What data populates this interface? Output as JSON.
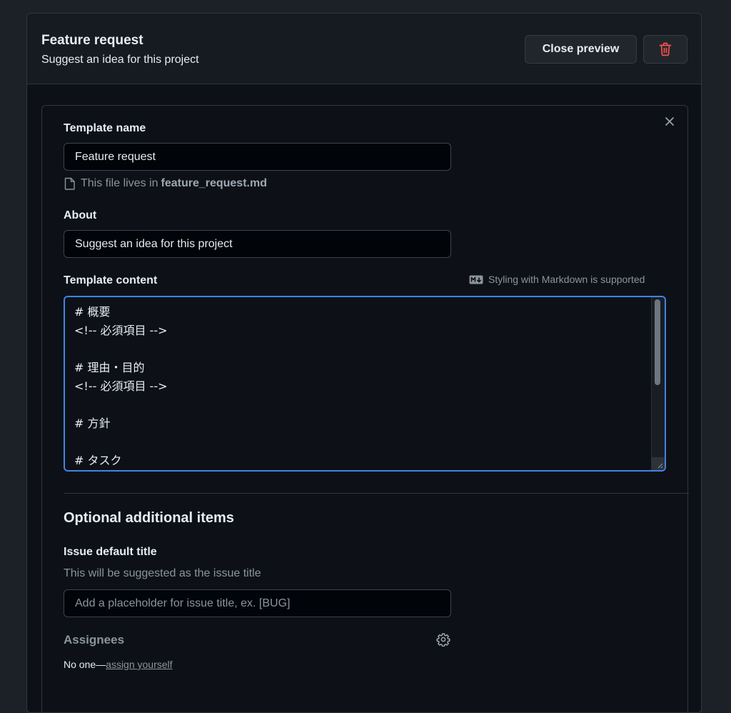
{
  "header": {
    "title": "Feature request",
    "subtitle": "Suggest an idea for this project",
    "close_preview_label": "Close preview"
  },
  "form": {
    "template_name_label": "Template name",
    "template_name_value": "Feature request",
    "file_note_prefix": "This file lives in",
    "file_name": "feature_request.md",
    "about_label": "About",
    "about_value": "Suggest an idea for this project",
    "content_label": "Template content",
    "markdown_hint": "Styling with Markdown is supported",
    "content_lines": [
      "# 概要",
      "<!-- 必須項目 -->",
      "",
      "# 理由・目的",
      "<!-- 必須項目 -->",
      "",
      "# 方針",
      "",
      "# タスク"
    ]
  },
  "optional": {
    "section_title": "Optional additional items",
    "default_title_label": "Issue default title",
    "default_title_help": "This will be suggested as the issue title",
    "default_title_placeholder": "Add a placeholder for issue title, ex. [BUG]",
    "assignees_label": "Assignees",
    "assignees_value_prefix": "No one—",
    "assign_yourself_label": "assign yourself"
  },
  "colors": {
    "accent": "#4184e4",
    "danger": "#f85149",
    "background": "#0d1117"
  }
}
